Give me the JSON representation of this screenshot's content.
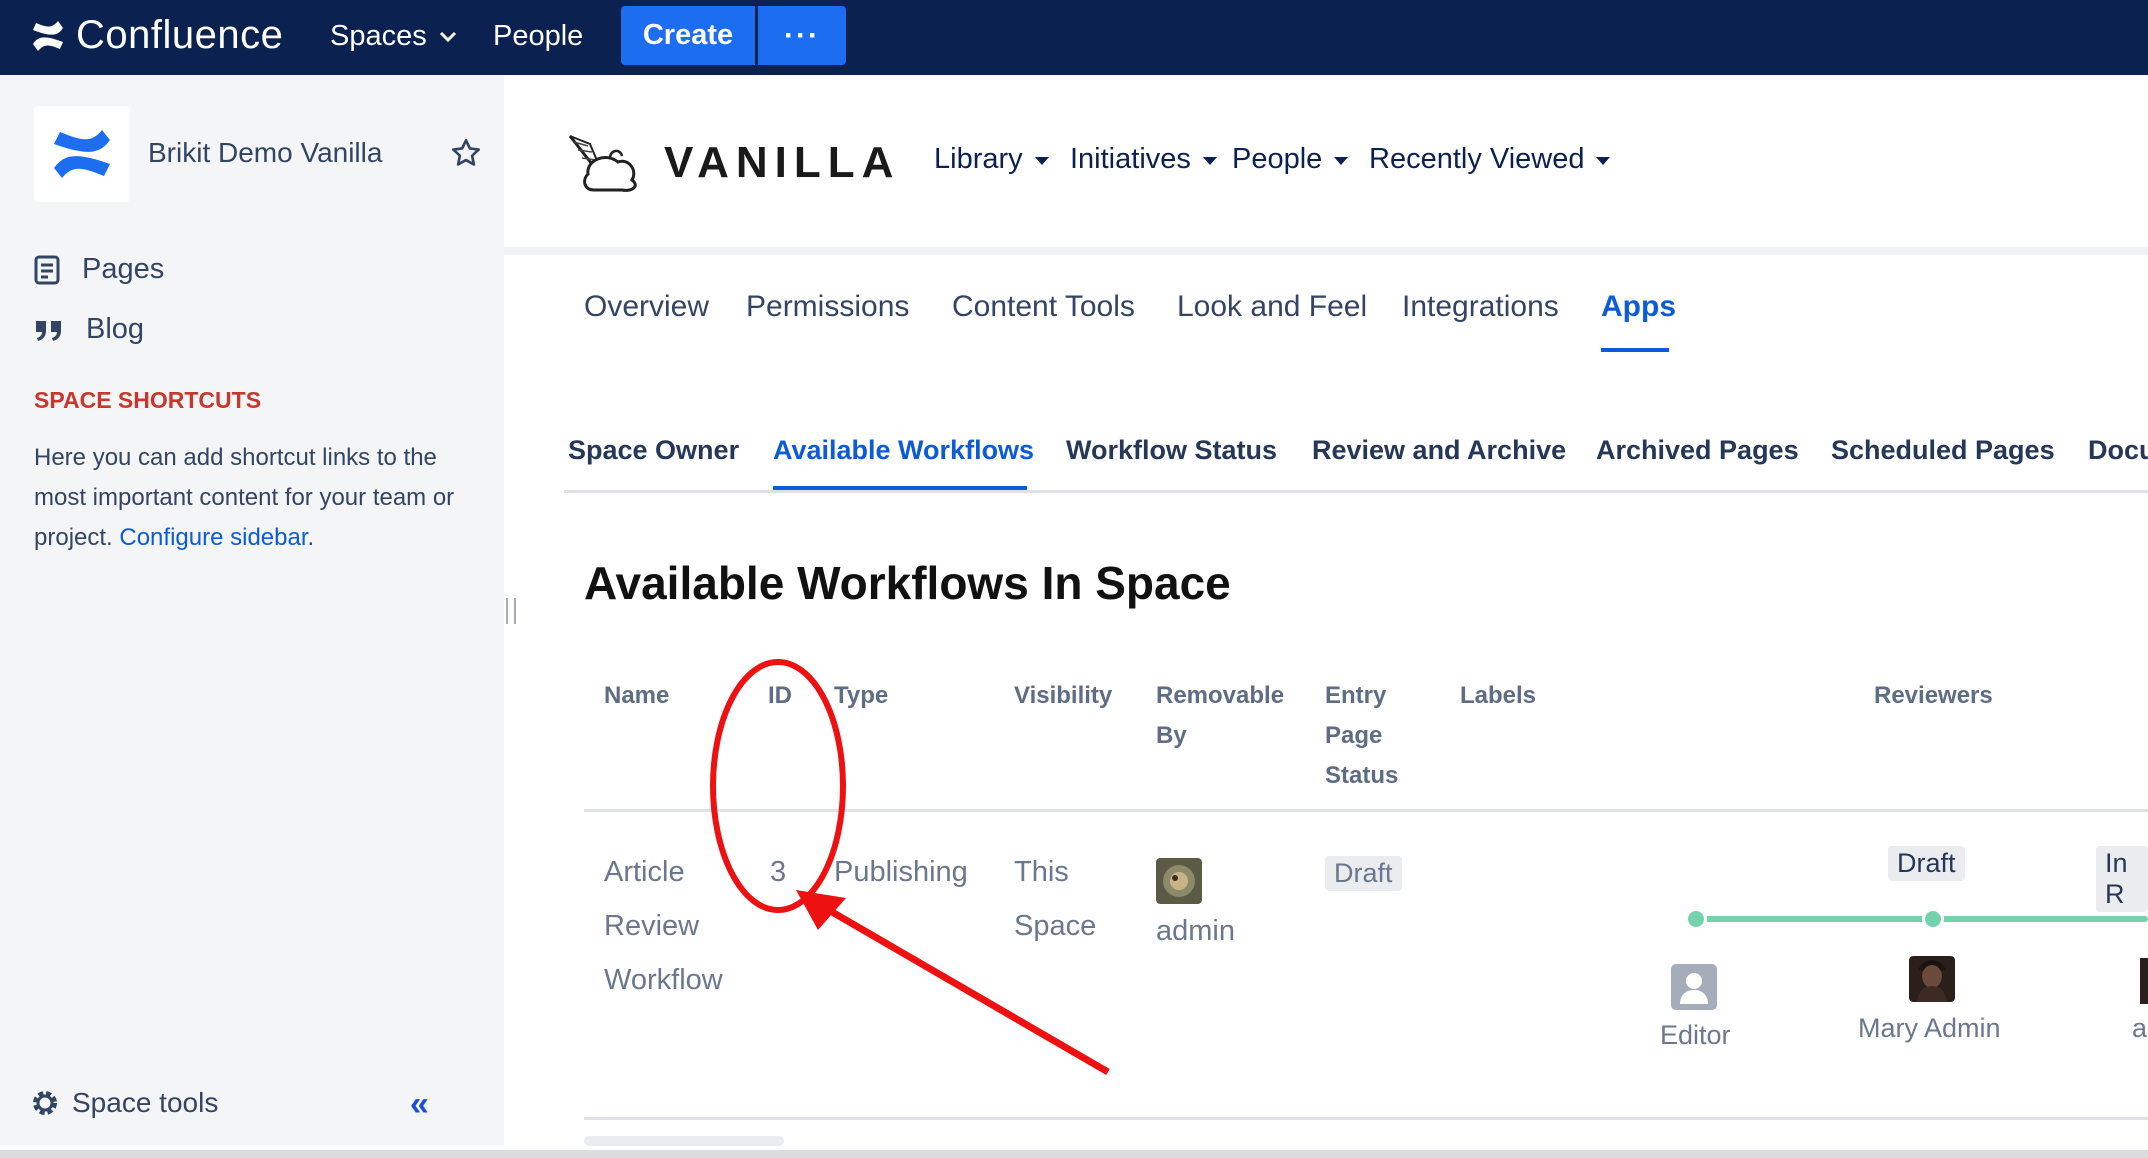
{
  "topbar": {
    "app_name": "Confluence",
    "spaces_label": "Spaces",
    "people_label": "People",
    "create_label": "Create",
    "more_label": "···"
  },
  "sidebar": {
    "space_name": "Brikit Demo Vanilla",
    "items": [
      {
        "label": "Pages",
        "icon": "page-icon"
      },
      {
        "label": "Blog",
        "icon": "quote-icon"
      }
    ],
    "shortcuts_title": "SPACE SHORTCUTS",
    "shortcuts_text": "Here you can add shortcut links to the most important content for your team or project.",
    "configure_link": "Configure sidebar",
    "shortcuts_end": ".",
    "space_tools_label": "Space tools",
    "collapse_label": "«"
  },
  "header": {
    "brand": "VANILLA",
    "nav": [
      "Library",
      "Initiatives",
      "People",
      "Recently Viewed"
    ]
  },
  "tabs": [
    "Overview",
    "Permissions",
    "Content Tools",
    "Look and Feel",
    "Integrations",
    "Apps"
  ],
  "active_tab": "Apps",
  "subtabs": [
    "Space Owner",
    "Available Workflows",
    "Workflow Status",
    "Review and Archive",
    "Archived Pages",
    "Scheduled Pages",
    "Docu"
  ],
  "active_subtab": "Available Workflows",
  "page_title": "Available Workflows In Space",
  "table": {
    "headers": {
      "name": "Name",
      "id": "ID",
      "type": "Type",
      "visibility": "Visibility",
      "removable_by_1": "Removable",
      "removable_by_2": "By",
      "entry_1": "Entry",
      "entry_2": "Page",
      "entry_3": "Status",
      "labels": "Labels",
      "reviewers": "Reviewers"
    },
    "row": {
      "name_1": "Article",
      "name_2": "Review",
      "name_3": "Workflow",
      "id": "3",
      "type": "Publishing",
      "visibility_1": "This",
      "visibility_2": "Space",
      "removable_by": "admin",
      "entry_status": "Draft",
      "stage_1": "Draft",
      "stage_2": "In R",
      "reviewer_1": "Editor",
      "reviewer_2": "Mary Admin",
      "reviewer_3": "a"
    }
  },
  "colors": {
    "topbar": "#0b2150",
    "accent": "#0c5bd8",
    "create": "#1d6df0",
    "annotation": "#ee1111",
    "workflow": "#74d3ad"
  }
}
